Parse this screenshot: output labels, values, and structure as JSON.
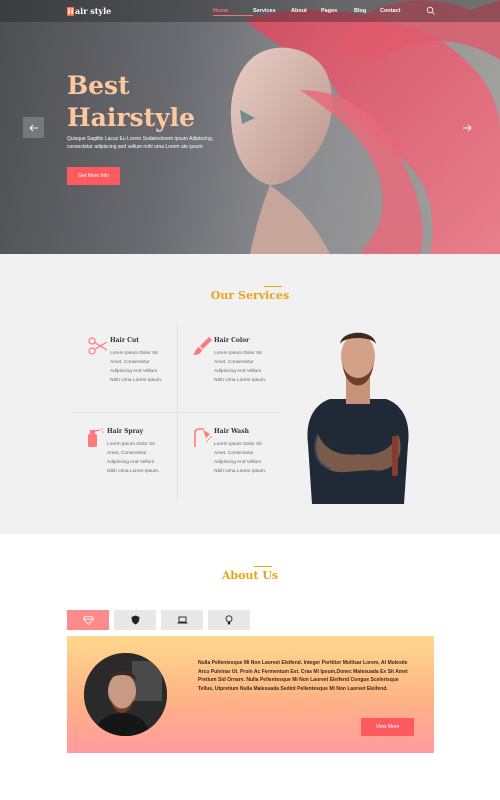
{
  "brand": {
    "logo_letter": "H",
    "logo_text": "air style",
    "accent": "#ff5a5f",
    "gold": "#e8a317"
  },
  "nav": {
    "items": [
      {
        "label": "Home",
        "active": true
      },
      {
        "label": "Services",
        "active": false
      },
      {
        "label": "About",
        "active": false
      },
      {
        "label": "Pages",
        "active": false
      },
      {
        "label": "Blog",
        "active": false
      },
      {
        "label": "Contact",
        "active": false
      }
    ],
    "search_icon": "search-icon"
  },
  "hero": {
    "title_line1": "Best",
    "title_line2": "Hairstyle",
    "text": "Quisque Sagittis Lacus Eu Lorem Sodaleslorem ipsum Adipiscing, consectetur adipiscing and vellum mihi urna Lorem ate ipsum",
    "button": "Get More Info",
    "prev_icon": "arrow-left-icon",
    "next_icon": "arrow-right-icon"
  },
  "services": {
    "title_plain": "Our",
    "title_rest": " Services",
    "items": [
      {
        "name": "Hair Cut",
        "desc": "Lorem Ipsum Dolor Sit Amet, Consectetur Adipiscing And Vellum Nibh Urna Lorem Ipsum.",
        "icon": "scissors-icon"
      },
      {
        "name": "Hair Color",
        "desc": "Lorem Ipsum Dolor Sit Amet, Consectetur Adipiscing And Vellum Nibh Urna Lorem Ipsum.",
        "icon": "brush-icon"
      },
      {
        "name": "Hair Spray",
        "desc": "Lorem Ipsum Dolor Sit Amet, Consectetur Adipiscing And Vellum Nibh Urna Lorem Ipsum.",
        "icon": "spray-icon"
      },
      {
        "name": "Hair Wash",
        "desc": "Lorem Ipsum Dolor Sit Amet, Consectetur Adipiscing And Vellum Nibh Urna Lorem Ipsum.",
        "icon": "shower-icon"
      }
    ]
  },
  "about": {
    "title": "About Us",
    "tabs": [
      {
        "icon": "diamond-icon",
        "active": true
      },
      {
        "icon": "shield-icon",
        "active": false
      },
      {
        "icon": "laptop-icon",
        "active": false
      },
      {
        "icon": "lightbulb-icon",
        "active": false
      }
    ],
    "text": "Nulla Pellentesque Mi Non Laoreet Eleifend. Integer Porttitor Mollisar Lorem, At Molestie Arcu Pulvinar Ut. Proin Ac Fermentum Est. Cras Mi Ipsum,Donec Malesuada Ex Sit Amet Pretium Sid Ornare. Nulla Pellentesque Mi Non Laoreet Eleifend Congue Scelerisque Tellus, Utpretium Nulla Malesuada Sedint Pellentesque Mi Non Laoreet Eleifend.",
    "button": "View More"
  }
}
